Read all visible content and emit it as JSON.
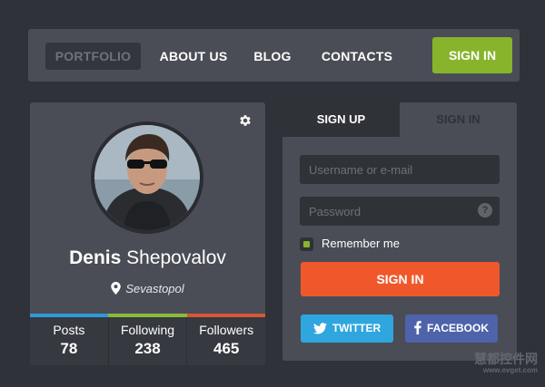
{
  "nav": {
    "items": [
      {
        "label": "PORTFOLIO",
        "active": true
      },
      {
        "label": "ABOUT US",
        "active": false
      },
      {
        "label": "BLOG",
        "active": false
      },
      {
        "label": "CONTACTS",
        "active": false
      }
    ],
    "signin_label": "SIGN IN"
  },
  "profile": {
    "first_name": "Denis",
    "last_name": "Shepovalov",
    "location": "Sevastopol",
    "settings_icon": "gear-icon",
    "stats": [
      {
        "label": "Posts",
        "value": "78"
      },
      {
        "label": "Following",
        "value": "238"
      },
      {
        "label": "Followers",
        "value": "465"
      }
    ],
    "stat_colors": [
      "#2f9ad8",
      "#8bb938",
      "#d9553a"
    ]
  },
  "auth": {
    "tabs": [
      {
        "label": "SIGN UP",
        "active": true
      },
      {
        "label": "SIGN IN",
        "active": false
      }
    ],
    "username_placeholder": "Username or e-mail",
    "password_placeholder": "Password",
    "help_icon_label": "?",
    "remember_label": "Remember me",
    "remember_checked": true,
    "signin_label": "SIGN IN",
    "twitter_label": "TWITTER",
    "facebook_label": "FACEBOOK"
  },
  "colors": {
    "accent_green": "#88b42c",
    "accent_orange": "#f0582b",
    "twitter_blue": "#2fa6de",
    "facebook_blue": "#4e63aa",
    "panel_bg": "#4a4d55",
    "page_bg": "#2f3238"
  },
  "watermark": {
    "cn": "慧都控件网",
    "url": "www.evget.com"
  }
}
